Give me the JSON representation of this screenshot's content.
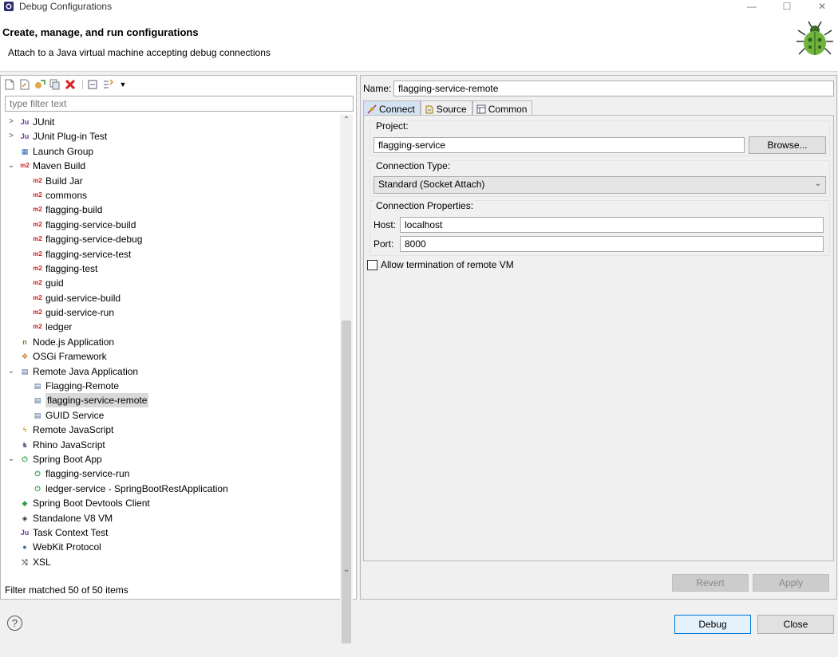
{
  "window": {
    "title": "Debug Configurations",
    "minimize": "—",
    "maximize": "☐",
    "close": "✕"
  },
  "header": {
    "title": "Create, manage, and run configurations",
    "description": "Attach to a Java virtual machine accepting debug connections"
  },
  "filter": {
    "placeholder": "type filter text"
  },
  "tree": [
    {
      "label": "JUnit",
      "indent": 0,
      "twisty": ">",
      "icon": "junit-icon",
      "glyph": "Ju"
    },
    {
      "label": "JUnit Plug-in Test",
      "indent": 0,
      "twisty": ">",
      "icon": "junit-plugin-icon",
      "glyph": "Ju"
    },
    {
      "label": "Launch Group",
      "indent": 0,
      "twisty": "",
      "icon": "launch-group-icon",
      "glyph": "▦"
    },
    {
      "label": "Maven Build",
      "indent": 0,
      "twisty": "⌄",
      "icon": "maven-icon",
      "glyph": "m2"
    },
    {
      "label": "Build Jar",
      "indent": 1,
      "twisty": "",
      "icon": "maven-icon",
      "glyph": "m2"
    },
    {
      "label": "commons",
      "indent": 1,
      "twisty": "",
      "icon": "maven-icon",
      "glyph": "m2"
    },
    {
      "label": "flagging-build",
      "indent": 1,
      "twisty": "",
      "icon": "maven-icon",
      "glyph": "m2"
    },
    {
      "label": "flagging-service-build",
      "indent": 1,
      "twisty": "",
      "icon": "maven-icon",
      "glyph": "m2"
    },
    {
      "label": "flagging-service-debug",
      "indent": 1,
      "twisty": "",
      "icon": "maven-icon",
      "glyph": "m2"
    },
    {
      "label": "flagging-service-test",
      "indent": 1,
      "twisty": "",
      "icon": "maven-icon",
      "glyph": "m2"
    },
    {
      "label": "flagging-test",
      "indent": 1,
      "twisty": "",
      "icon": "maven-icon",
      "glyph": "m2"
    },
    {
      "label": "guid",
      "indent": 1,
      "twisty": "",
      "icon": "maven-icon",
      "glyph": "m2"
    },
    {
      "label": "guid-service-build",
      "indent": 1,
      "twisty": "",
      "icon": "maven-icon",
      "glyph": "m2"
    },
    {
      "label": "guid-service-run",
      "indent": 1,
      "twisty": "",
      "icon": "maven-icon",
      "glyph": "m2"
    },
    {
      "label": "ledger",
      "indent": 1,
      "twisty": "",
      "icon": "maven-icon",
      "glyph": "m2"
    },
    {
      "label": "Node.js Application",
      "indent": 0,
      "twisty": "",
      "icon": "nodejs-icon",
      "glyph": "n"
    },
    {
      "label": "OSGi Framework",
      "indent": 0,
      "twisty": "",
      "icon": "osgi-icon",
      "glyph": "✥"
    },
    {
      "label": "Remote Java Application",
      "indent": 0,
      "twisty": "⌄",
      "icon": "remote-java-icon",
      "glyph": "▤"
    },
    {
      "label": "Flagging-Remote",
      "indent": 1,
      "twisty": "",
      "icon": "remote-java-icon",
      "glyph": "▤"
    },
    {
      "label": "flagging-service-remote",
      "indent": 1,
      "twisty": "",
      "icon": "remote-java-icon",
      "glyph": "▤",
      "selected": true
    },
    {
      "label": "GUID Service",
      "indent": 1,
      "twisty": "",
      "icon": "remote-java-icon",
      "glyph": "▤"
    },
    {
      "label": "Remote JavaScript",
      "indent": 0,
      "twisty": "",
      "icon": "remote-javascript-icon",
      "glyph": "ϟ"
    },
    {
      "label": "Rhino JavaScript",
      "indent": 0,
      "twisty": "",
      "icon": "rhino-icon",
      "glyph": "♞"
    },
    {
      "label": "Spring Boot App",
      "indent": 0,
      "twisty": "⌄",
      "icon": "spring-boot-icon",
      "glyph": "⏻"
    },
    {
      "label": "flagging-service-run",
      "indent": 1,
      "twisty": "",
      "icon": "spring-boot-icon",
      "glyph": "⏻"
    },
    {
      "label": "ledger-service - SpringBootRestApplication",
      "indent": 1,
      "twisty": "",
      "icon": "spring-boot-icon",
      "glyph": "⏻"
    },
    {
      "label": "Spring Boot Devtools Client",
      "indent": 0,
      "twisty": "",
      "icon": "spring-devtools-icon",
      "glyph": "◆"
    },
    {
      "label": "Standalone V8 VM",
      "indent": 0,
      "twisty": "",
      "icon": "v8-icon",
      "glyph": "◈"
    },
    {
      "label": "Task Context Test",
      "indent": 0,
      "twisty": "",
      "icon": "task-context-icon",
      "glyph": "Ju"
    },
    {
      "label": "WebKit Protocol",
      "indent": 0,
      "twisty": "",
      "icon": "webkit-icon",
      "glyph": "●"
    },
    {
      "label": "XSL",
      "indent": 0,
      "twisty": "",
      "icon": "xsl-icon",
      "glyph": "⤭"
    }
  ],
  "filter_status": "Filter matched 50 of 50 items",
  "config": {
    "name_label": "Name:",
    "name_value": "flagging-service-remote",
    "tabs": [
      {
        "label": "Connect",
        "active": true
      },
      {
        "label": "Source",
        "active": false
      },
      {
        "label": "Common",
        "active": false
      }
    ],
    "project_group": "Project:",
    "project_value": "flagging-service",
    "browse_label": "Browse...",
    "connection_type_group": "Connection Type:",
    "connection_type_value": "Standard (Socket Attach)",
    "properties_group": "Connection Properties:",
    "host_label": "Host:",
    "host_value": "localhost",
    "port_label": "Port:",
    "port_value": "8000",
    "allow_termination_label": "Allow termination of remote VM",
    "allow_termination_checked": false,
    "revert_label": "Revert",
    "apply_label": "Apply"
  },
  "footer": {
    "help": "?",
    "debug_label": "Debug",
    "close_label": "Close"
  }
}
